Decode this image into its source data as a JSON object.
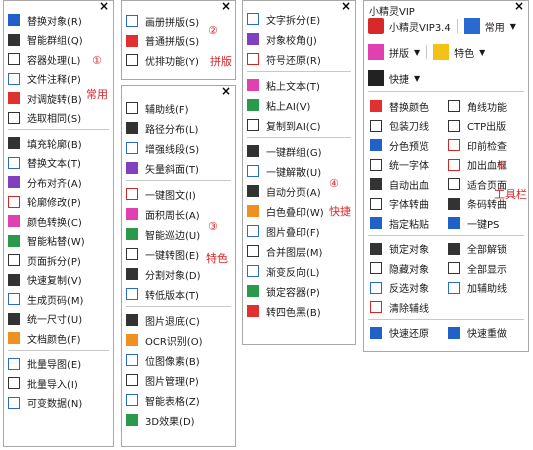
{
  "close_glyph": "×",
  "panel1": {
    "items": [
      {
        "label": "替换对象(R)",
        "icon": "replace-object-icon"
      },
      {
        "label": "智能群组(Q)",
        "icon": "smart-group-icon"
      },
      {
        "label": "容器处理(L)",
        "icon": "container-icon"
      },
      {
        "label": "文件注释(P)",
        "icon": "file-note-icon"
      },
      {
        "label": "对调旋转(B)",
        "icon": "rotate-swap-icon"
      },
      {
        "label": "选取相同(S)",
        "icon": "select-same-icon"
      },
      {
        "label": "填充轮廓(B)",
        "icon": "fill-outline-icon"
      },
      {
        "label": "替换文本(T)",
        "icon": "replace-text-icon"
      },
      {
        "label": "分布对齐(A)",
        "icon": "distribute-align-icon"
      },
      {
        "label": "轮廓修改(P)",
        "icon": "outline-edit-icon"
      },
      {
        "label": "颜色转换(C)",
        "icon": "color-convert-icon"
      },
      {
        "label": "智能粘替(W)",
        "icon": "smart-paste-icon"
      },
      {
        "label": "页面拆分(P)",
        "icon": "page-split-icon"
      },
      {
        "label": "快速复制(V)",
        "icon": "quick-copy-icon"
      },
      {
        "label": "生成页码(M)",
        "icon": "page-number-icon"
      },
      {
        "label": "统一尺寸(U)",
        "icon": "unify-size-icon"
      },
      {
        "label": "文档颜色(F)",
        "icon": "doc-color-icon"
      },
      {
        "label": "批量导图(E)",
        "icon": "batch-export-icon"
      },
      {
        "label": "批量导入(I)",
        "icon": "batch-import-icon"
      },
      {
        "label": "可变数据(N)",
        "icon": "variable-data-icon"
      }
    ],
    "marker": "①",
    "category": "常用"
  },
  "panel2": {
    "items": [
      {
        "label": "画册拼版(S)",
        "icon": "album-imposition-icon"
      },
      {
        "label": "普通拼版(S)",
        "icon": "normal-imposition-icon"
      },
      {
        "label": "优排功能(Y)",
        "icon": "optimize-layout-icon"
      }
    ],
    "marker": "②",
    "category": "拼版"
  },
  "panel3": {
    "items": [
      {
        "label": "辅助线(F)",
        "icon": "guideline-icon"
      },
      {
        "label": "路径分布(L)",
        "icon": "path-distribute-icon"
      },
      {
        "label": "增强线段(S)",
        "icon": "enhance-segment-icon"
      },
      {
        "label": "矢量斜面(T)",
        "icon": "vector-bevel-icon"
      },
      {
        "label": "一键图文(I)",
        "icon": "one-click-graphic-icon"
      },
      {
        "label": "面积周长(A)",
        "icon": "area-perimeter-icon"
      },
      {
        "label": "智能巡边(U)",
        "icon": "smart-edge-icon"
      },
      {
        "label": "一键转图(E)",
        "icon": "one-click-convert-icon"
      },
      {
        "label": "分割对象(D)",
        "icon": "split-object-icon"
      },
      {
        "label": "转低版本(T)",
        "icon": "downgrade-version-icon"
      },
      {
        "label": "图片退底(C)",
        "icon": "image-cutout-icon"
      },
      {
        "label": "OCR识别(O)",
        "icon": "ocr-icon"
      },
      {
        "label": "位图像素(B)",
        "icon": "bitmap-pixel-icon"
      },
      {
        "label": "图片管理(P)",
        "icon": "image-manage-icon"
      },
      {
        "label": "智能表格(Z)",
        "icon": "smart-table-icon"
      },
      {
        "label": "3D效果(D)",
        "icon": "3d-effect-icon"
      }
    ],
    "marker": "③",
    "category": "特色"
  },
  "panel4": {
    "items": [
      {
        "label": "文字拆分(E)",
        "icon": "text-split-icon"
      },
      {
        "label": "对象校角(J)",
        "icon": "object-corner-icon"
      },
      {
        "label": "符号还原(R)",
        "icon": "symbol-restore-icon"
      },
      {
        "label": "粘上文本(T)",
        "icon": "paste-text-icon"
      },
      {
        "label": "粘上AI(V)",
        "icon": "paste-ai-icon"
      },
      {
        "label": "复制到AI(C)",
        "icon": "copy-to-ai-icon"
      },
      {
        "label": "一键群组(G)",
        "icon": "one-click-group-icon"
      },
      {
        "label": "一键解散(U)",
        "icon": "one-click-ungroup-icon"
      },
      {
        "label": "自动分页(A)",
        "icon": "auto-paginate-icon"
      },
      {
        "label": "白色叠印(W)",
        "icon": "white-overprint-icon"
      },
      {
        "label": "图片叠印(F)",
        "icon": "image-overprint-icon"
      },
      {
        "label": "合并图层(M)",
        "icon": "merge-layers-icon"
      },
      {
        "label": "渐变反向(L)",
        "icon": "gradient-reverse-icon"
      },
      {
        "label": "锁定容器(P)",
        "icon": "lock-container-icon"
      },
      {
        "label": "转四色黑(B)",
        "icon": "four-color-black-icon"
      }
    ],
    "marker": "④",
    "category": "快捷"
  },
  "panel5": {
    "title": "小精灵VIP",
    "version_label": "小精灵VIP3.4",
    "common_label": "常用",
    "imposition_label": "拼版",
    "feature_label": "特色",
    "shortcut_label": "快捷",
    "grid": [
      [
        "替换颜色",
        "角线功能"
      ],
      [
        "包装刀线",
        "CTP出版"
      ],
      [
        "分色预览",
        "印前检查"
      ],
      [
        "统一字体",
        "加出血框"
      ],
      [
        "自动出血",
        "适合页面"
      ],
      [
        "字体转曲",
        "条码转曲"
      ],
      [
        "指定粘贴",
        "一键PS"
      ],
      [
        "锁定对象",
        "全部解锁"
      ],
      [
        "隐藏对象",
        "全部显示"
      ],
      [
        "反选对象",
        "加辅助线"
      ],
      [
        "清除辅线",
        ""
      ],
      [
        "快速还原",
        "快速重做"
      ]
    ],
    "marker": "⑤",
    "category": "工具栏"
  }
}
